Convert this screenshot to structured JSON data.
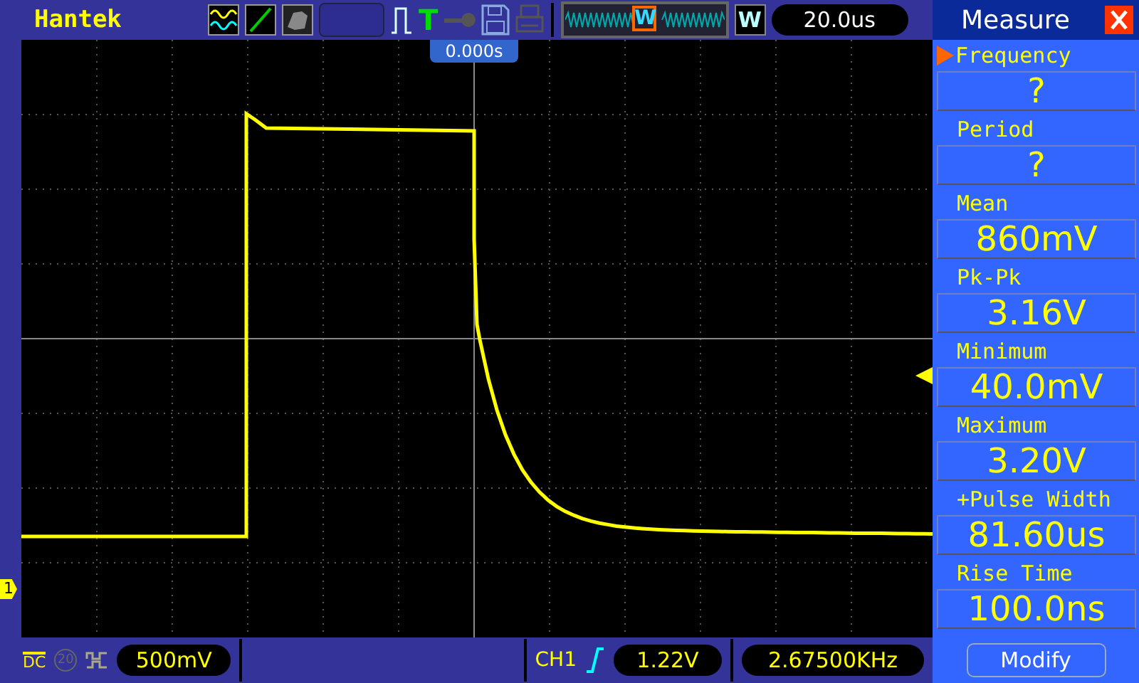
{
  "top_bar": {
    "brand": "Hantek",
    "trigger_type": "T",
    "overview_marker": "W",
    "window_button": "W",
    "timebase": "20.0us"
  },
  "scope": {
    "trigger_position": "0.000s",
    "channel_marker": "1"
  },
  "bottom_bar": {
    "coupling": "DC",
    "bandwidth_limit": "20",
    "volts_per_div": "500mV",
    "trigger_source": "CH1",
    "trigger_level": "1.22V",
    "frequency": "2.67500KHz"
  },
  "panel": {
    "title": "Measure",
    "measurements": [
      {
        "label": "Frequency",
        "value": "?",
        "selected": true
      },
      {
        "label": "Period",
        "value": "?",
        "selected": false
      },
      {
        "label": "Mean",
        "value": "860mV",
        "selected": false
      },
      {
        "label": "Pk-Pk",
        "value": "3.16V",
        "selected": false
      },
      {
        "label": "Minimum",
        "value": "40.0mV",
        "selected": false
      },
      {
        "label": "Maximum",
        "value": "3.20V",
        "selected": false
      },
      {
        "label": "+Pulse Width",
        "value": "81.60us",
        "selected": false
      },
      {
        "label": "Rise Time",
        "value": "100.0ns",
        "selected": false
      }
    ],
    "button": "Modify"
  }
}
